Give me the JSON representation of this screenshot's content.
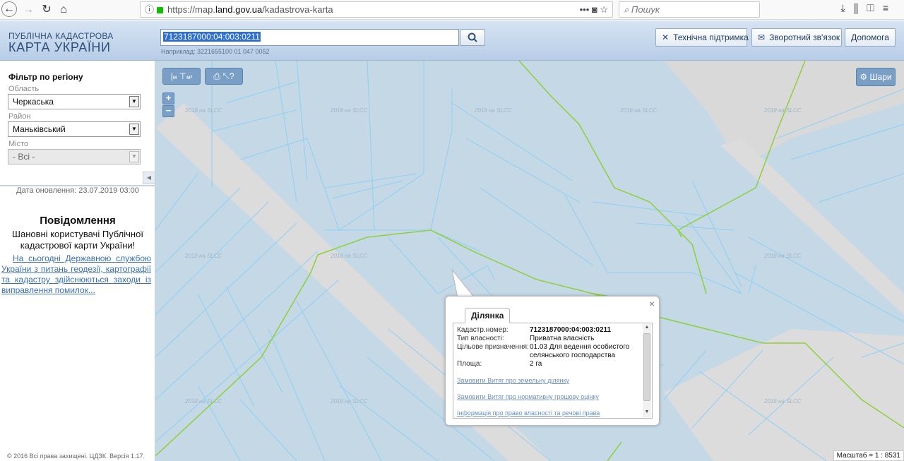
{
  "browser": {
    "url_prefix": "https://map.",
    "url_host": "land.gov.ua",
    "url_path": "/kadastrova-karta",
    "url_actions": "••• ◙ ☆",
    "search_placeholder": "Пошук",
    "icons": [
      "download-icon",
      "library-icon",
      "sidebar-icon",
      "menu-icon"
    ]
  },
  "header": {
    "logo_top": "ПУБЛІЧНА КАДАСТРОВА",
    "logo_bottom": "КАРТА УКРАЇНИ",
    "cadastral_value": "7123187000:04:003:0211",
    "example_hint": "Наприклад: 3221655100 01 047 0052",
    "btn_support": "Технічна підтримка",
    "btn_feedback": "Зворотний зв'язок",
    "btn_help": "Допомога"
  },
  "sidebar": {
    "filter_title": "Фільтр по регіону",
    "oblast_label": "Область",
    "oblast_value": "Черкаська",
    "rayon_label": "Район",
    "rayon_value": "Маньківський",
    "city_label": "Місто",
    "city_value": "- Всі -",
    "update_date": "Дата оновлення: 23.07.2019 03:00",
    "notice_title": "Повідомлення",
    "notice_text": "Шановні користувачі Публічної кадастрової карти України!",
    "notice_link": "На сьогодні Державною службою України з питань геодезії, картографії та кадастру здійснюються заходи із виправлення помилок...",
    "copyright": "© 2016 Всі права захищені. ЦДЗК. Версія 1.17."
  },
  "map": {
    "tool_measure_label": "м",
    "tool_area_label": "м²",
    "zoom_in": "+",
    "zoom_out": "−",
    "layers_label": "Шари",
    "watermark": "2018 на SLCC",
    "scale": "Масштаб = 1 : 8531",
    "colors": {
      "background": "#c4d8e6",
      "parcel_line": "#8ecff5",
      "boundary": "#8fcf3c",
      "road": "#dcdcdc"
    }
  },
  "popup": {
    "tab_label": "Ділянка",
    "close": "×",
    "rows": [
      {
        "label": "Кадастр.номер:",
        "value": "7123187000:04:003:0211"
      },
      {
        "label": "Тип власності:",
        "value": "Приватна власність"
      },
      {
        "label": "Цільове призначення:",
        "value": "01.03 Для ведення особистого селянського господарства"
      },
      {
        "label": "Площа:",
        "value": "2 га"
      }
    ],
    "links": [
      "Замовити Витяг про земельну ділянку",
      "Замовити Витяг про нормативну грошову оцінку",
      "Інформація про право власності та речові права"
    ]
  }
}
